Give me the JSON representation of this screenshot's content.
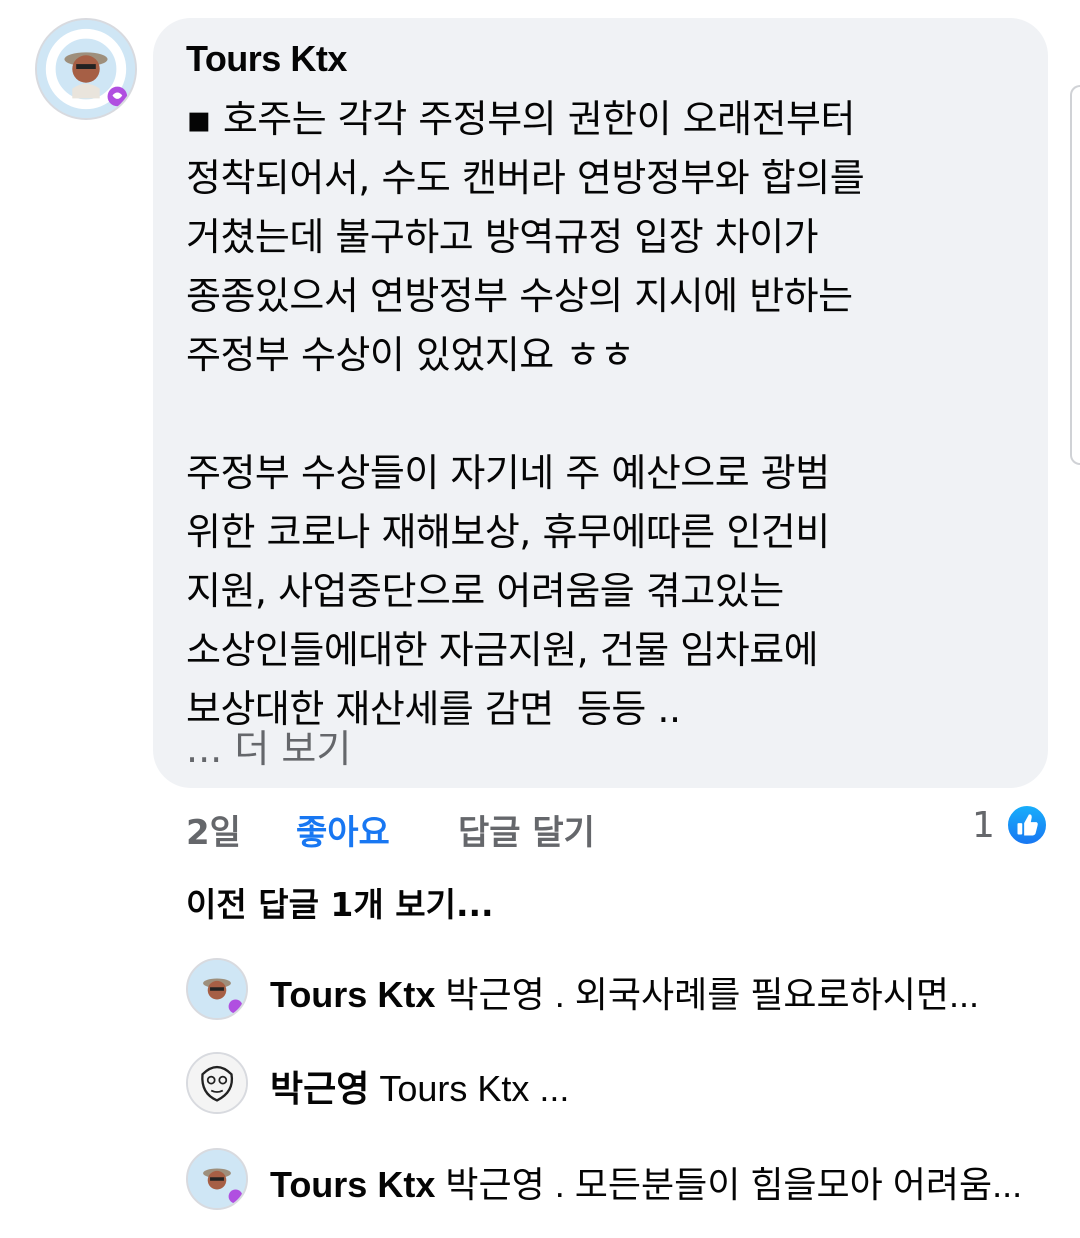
{
  "comment": {
    "author": "Tours Ktx",
    "body": "▪ 호주는 각각 주정부의 권한이 오래전부터\n정착되어서, 수도 캔버라 연방정부와 합의를\n거쳤는데 불구하고 방역규정 입장 차이가\n종종있으서 연방정부 수상의 지시에 반하는\n주정부 수상이 있었지요 ㅎㅎ\n\n주정부 수상들이 자기네 주 예산으로 광범\n위한 코로나 재해보상, 휴무에따른 인건비\n지원, 사업중단으로 어려움을 겪고있는\n소상인들에대한 자금지원, 건물 임차료에\n보상대한 재산세를 감면  등등 ..",
    "see_more": "... 더 보기",
    "time": "2일",
    "like_label": "좋아요",
    "reply_label": "답글 달기",
    "reaction_count": "1",
    "reaction_icon": "like-thumb-icon"
  },
  "previous_replies_label": "이전 답글 1개 보기...",
  "replies": [
    {
      "author": "Tours Ktx",
      "text": " 박근영 . 외국사례를 필요로하시면..."
    },
    {
      "author": "박근영",
      "text": " Tours Ktx ..."
    },
    {
      "author": "Tours Ktx",
      "text": " 박근영 . 모든분들이 힘을모아 어려움..."
    }
  ],
  "colors": {
    "bubble": "#f0f2f5",
    "accent": "#1877f2",
    "muted": "#65676b"
  }
}
